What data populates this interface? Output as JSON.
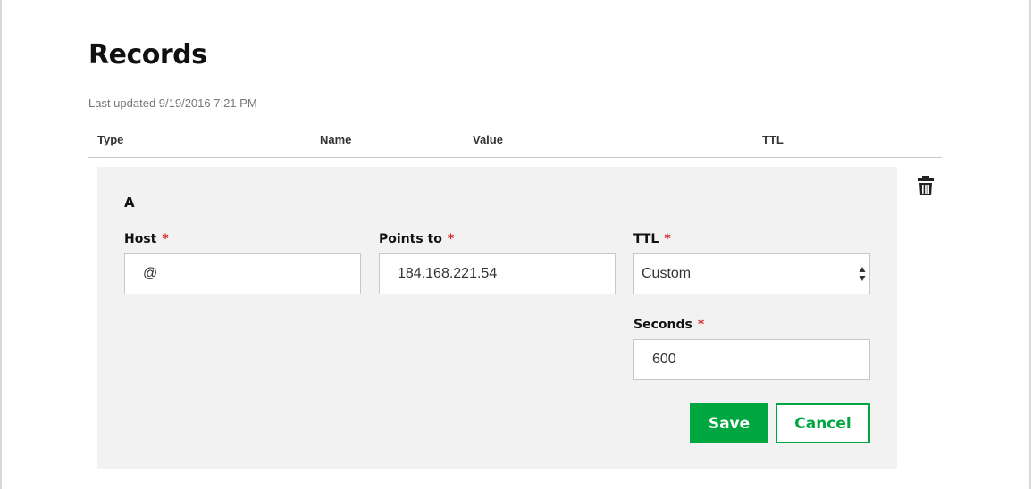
{
  "page": {
    "title": "Records",
    "last_updated": "Last updated 9/19/2016 7:21 PM"
  },
  "table": {
    "columns": [
      "Type",
      "Name",
      "Value",
      "TTL"
    ]
  },
  "record": {
    "type": "A",
    "host_label": "Host",
    "host_value": "@",
    "points_to_label": "Points to",
    "points_to_value": "184.168.221.54",
    "ttl_label": "TTL",
    "ttl_selected": "Custom",
    "seconds_label": "Seconds",
    "seconds_value": "600",
    "required_marker": "*"
  },
  "actions": {
    "save_label": "Save",
    "cancel_label": "Cancel"
  },
  "icons": {
    "delete": "trash-icon",
    "select": "select-arrows-icon"
  },
  "colors": {
    "accent": "#00a63f",
    "required": "#d4262b",
    "panel": "#f2f2f2"
  }
}
